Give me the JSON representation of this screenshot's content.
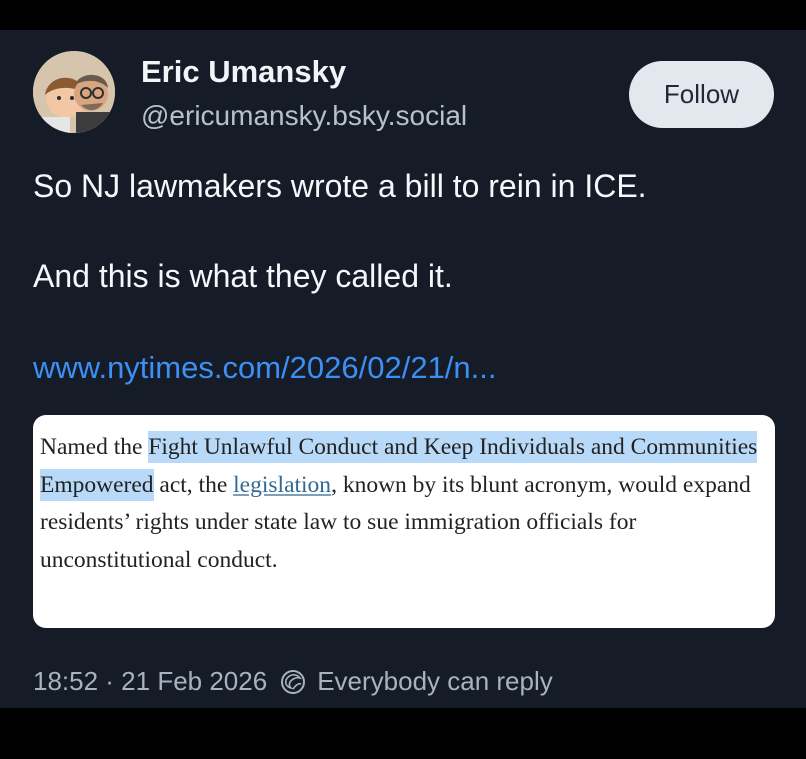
{
  "post": {
    "author": {
      "name": "Eric Umansky",
      "handle": "@ericumansky.bsky.social"
    },
    "follow_label": "Follow",
    "text_line_1": "So NJ lawmakers wrote a bill to rein in ICE.",
    "text_line_2": "And this is what they called it.",
    "link": "www.nytimes.com/2026/02/21/n...",
    "quote": {
      "part_1": "Named the ",
      "highlight": "Fight Unlawful Conduct and Keep Individuals and Communities Empowered",
      "part_2": " act, the ",
      "link_word": "legislation",
      "part_3": ", known by its blunt acronym, would expand residents’ rights under state law to sue immigration officials for unconstitutional conduct."
    },
    "timestamp": "18:52 · 21 Feb 2026",
    "reply_setting": "Everybody can reply"
  },
  "icons": {
    "avatar": "profile-photo",
    "reply": "reply-permission-icon"
  },
  "colors": {
    "background": "#000000",
    "card": "#151b27",
    "link": "#3d8ff3",
    "highlight": "#b8d9f7"
  }
}
